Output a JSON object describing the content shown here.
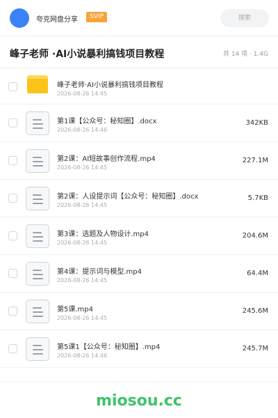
{
  "topbar": {
    "app_name": "夸克网盘分享",
    "badge": "SVIP",
    "search_placeholder": "搜索"
  },
  "folder": {
    "title": "峰子老师 ·AI小说暴利搞钱项目教程",
    "meta": "共 14 项 · 1.4G"
  },
  "items": [
    {
      "name": "峰子老师·AI小说暴利搞钱项目教程",
      "date": "2026-08-26 14:45",
      "size": "",
      "type": "folder"
    },
    {
      "name": "第1课【公众号：秘知圈】.docx",
      "date": "2026-08-26 14:46",
      "size": "342KB",
      "type": "file"
    },
    {
      "name": "第2课：AI短故事创作流程.mp4",
      "date": "2026-08-26 14:45",
      "size": "227.1M",
      "type": "file"
    },
    {
      "name": "第2课：人设提示词【公众号：秘知圈】.docx",
      "date": "2026-08-26 14:45",
      "size": "5.7KB",
      "type": "file"
    },
    {
      "name": "第3课：选题及人物设计.mp4",
      "date": "2026-08-26 14:45",
      "size": "204.6M",
      "type": "file"
    },
    {
      "name": "第4课：提示词与模型.mp4",
      "date": "2026-08-26 14:45",
      "size": "64.4M",
      "type": "file"
    },
    {
      "name": "第5课.mp4",
      "date": "2026-08-26 14:45",
      "size": "245.6M",
      "type": "file"
    },
    {
      "name": "第5课1【公众号：秘知圈】.mp4",
      "date": "2026-08-26 14:46",
      "size": "245.7M",
      "type": "file"
    }
  ],
  "watermark": "miosou.cc",
  "colors": {
    "avatar": "#3b82f6",
    "badge": "#f8a23a",
    "folder": "#fbc21a",
    "watermark": "#3ec36a"
  }
}
